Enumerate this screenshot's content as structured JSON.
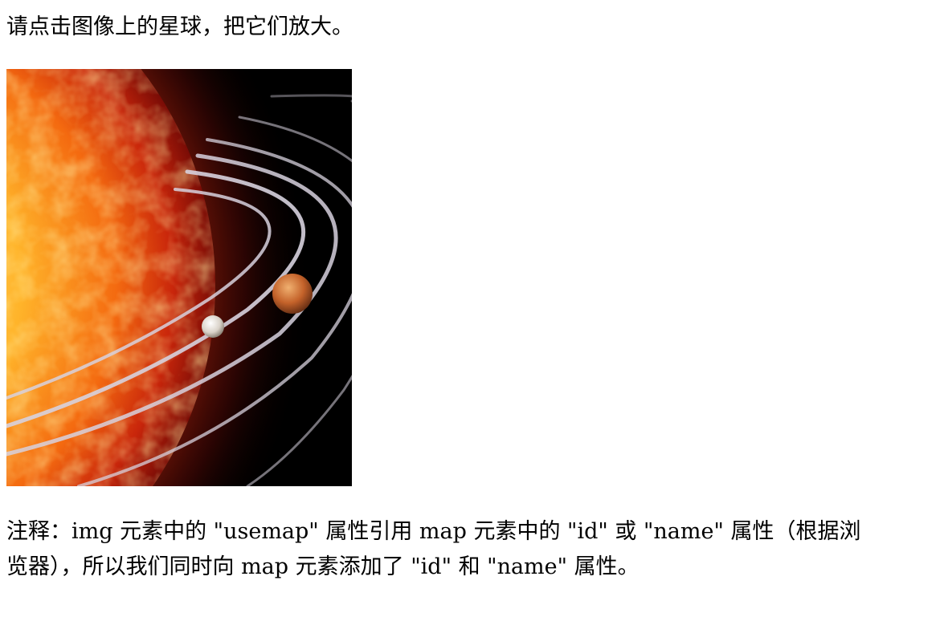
{
  "instruction": "请点击图像上的星球，把它们放大。",
  "image": {
    "icon": "sun-and-planets-image",
    "colors": {
      "space": "#000000",
      "sun_core": "#ffd35a",
      "sun_mid": "#f47a12",
      "sun_edge": "#b81d0a",
      "orbit": "#cfc9d6",
      "venus": "#c4622a",
      "mercury": "#d9d2c8"
    }
  },
  "hotspots": [
    {
      "name": "Sun"
    },
    {
      "name": "Mercury"
    },
    {
      "name": "Venus"
    }
  ],
  "note": {
    "line1": "注释：img 元素中的 \"usemap\" 属性引用 map 元素中的 \"id\" 或 \"name\" 属性（根据浏",
    "line2": "览器），所以我们同时向 map 元素添加了 \"id\" 和 \"name\" 属性。"
  }
}
